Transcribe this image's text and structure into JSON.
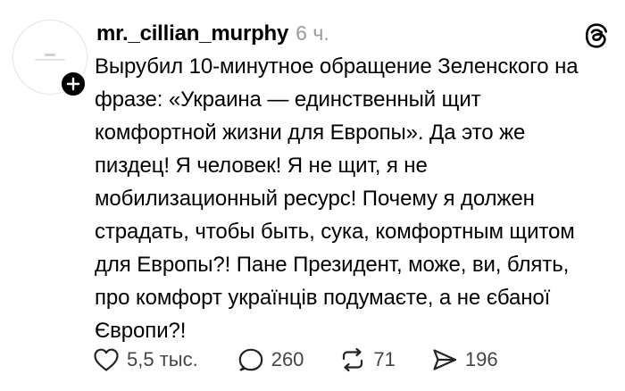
{
  "post": {
    "username": "mr._cillian_murphy",
    "time": "6 ч.",
    "text": "Вырубил 10-минутное обращение Зеленского на\nфразе: «Украина — единственный щит\nкомфортной жизни для Европы». Да это же\nпиздец! Я человек! Я не щит, я не\nмобилизационный ресурс! Почему я должен\nстрадать, чтобы быть, сука, комфортным щитом\nдля Европы?! Пане Президент, може, ви, блять,\nпро комфорт українців подумаєте, а не єбаної\nЄвропи?!"
  },
  "actions": {
    "likes": "5,5 тыс.",
    "replies": "260",
    "reposts": "71",
    "shares": "196"
  },
  "icons": {
    "avatar": "profile-avatar",
    "follow": "plus-icon",
    "brand": "threads-logo-icon",
    "like": "heart-icon",
    "reply": "speech-bubble-icon",
    "repost": "repost-icon",
    "share": "send-icon"
  }
}
